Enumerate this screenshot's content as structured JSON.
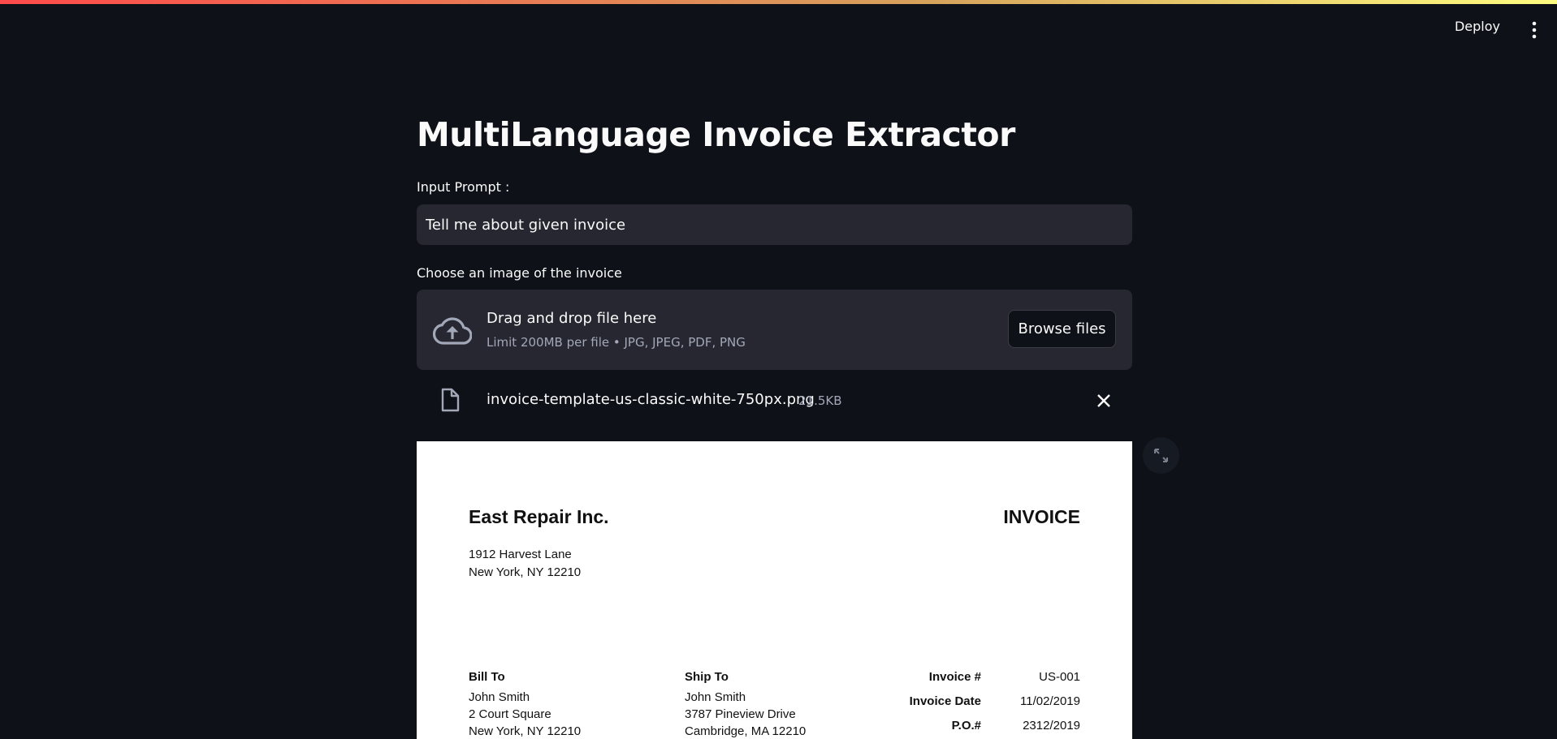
{
  "header": {
    "deploy_label": "Deploy",
    "menu_icon": "vertical-ellipsis-icon"
  },
  "main": {
    "title": "MultiLanguage Invoice Extractor",
    "prompt_label": "Input Prompt :",
    "prompt_value": "Tell me about given invoice",
    "uploader_label": "Choose an image of the invoice",
    "dropzone": {
      "icon": "cloud-upload-icon",
      "title": "Drag and drop file here",
      "subtitle": "Limit 200MB per file • JPG, JPEG, PDF, PNG",
      "browse_label": "Browse files"
    },
    "uploaded_file": {
      "icon": "file-icon",
      "name": "invoice-template-us-classic-white-750px.png",
      "size": "21.5KB",
      "remove_icon": "close-icon"
    },
    "expand_icon": "fullscreen-icon"
  },
  "invoice": {
    "company": "East Repair Inc.",
    "doc_title": "INVOICE",
    "address_line1": "1912 Harvest Lane",
    "address_line2": "New York, NY 12210",
    "bill_to": {
      "heading": "Bill To",
      "name": "John Smith",
      "line1": "2 Court Square",
      "line2": "New York, NY 12210"
    },
    "ship_to": {
      "heading": "Ship To",
      "name": "John Smith",
      "line1": "3787 Pineview Drive",
      "line2": "Cambridge, MA 12210"
    },
    "meta": [
      {
        "label": "Invoice #",
        "value": "US-001"
      },
      {
        "label": "Invoice Date",
        "value": "11/02/2019"
      },
      {
        "label": "P.O.#",
        "value": "2312/2019"
      }
    ]
  }
}
